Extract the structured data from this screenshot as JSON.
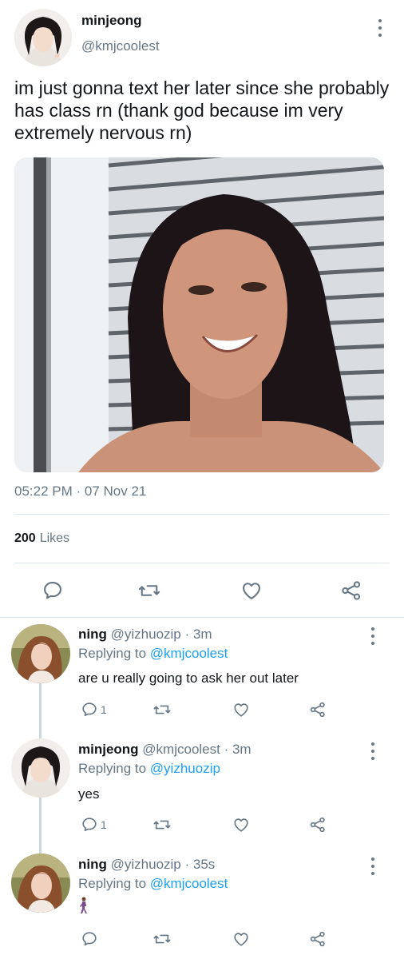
{
  "main": {
    "author_name": "minjeong",
    "handle": "@kmjcoolest",
    "text": "im just gonna text her later since she probably has class rn (thank god because im very extremely nervous rn)",
    "timestamp": "05:22 PM · 07 Nov 21",
    "likes_count": "200",
    "likes_label": "Likes"
  },
  "icons": {
    "reply": "reply-icon",
    "retweet": "retweet-icon",
    "like": "heart-icon",
    "share": "share-icon",
    "more": "more-vertical-icon"
  },
  "replies": [
    {
      "name": "ning",
      "handle": "@yizhuozip",
      "time": "· 3m",
      "replying_label": "Replying to",
      "replying_to": "@kmjcoolest",
      "text": "are u really going to ask her out later",
      "reply_count": "1"
    },
    {
      "name": "minjeong",
      "handle": "@kmjcoolest",
      "time": "· 3m",
      "replying_label": "Replying to",
      "replying_to": "@yizhuozip",
      "text": "yes",
      "reply_count": "1"
    },
    {
      "name": "ning",
      "handle": "@yizhuozip",
      "time": "· 35s",
      "replying_label": "Replying to",
      "replying_to": "@kmjcoolest",
      "text": "",
      "reply_count": ""
    }
  ],
  "colors": {
    "text_primary": "#14171a",
    "text_secondary": "#657786",
    "link": "#1da1f2",
    "divider": "#e1e8ed"
  }
}
